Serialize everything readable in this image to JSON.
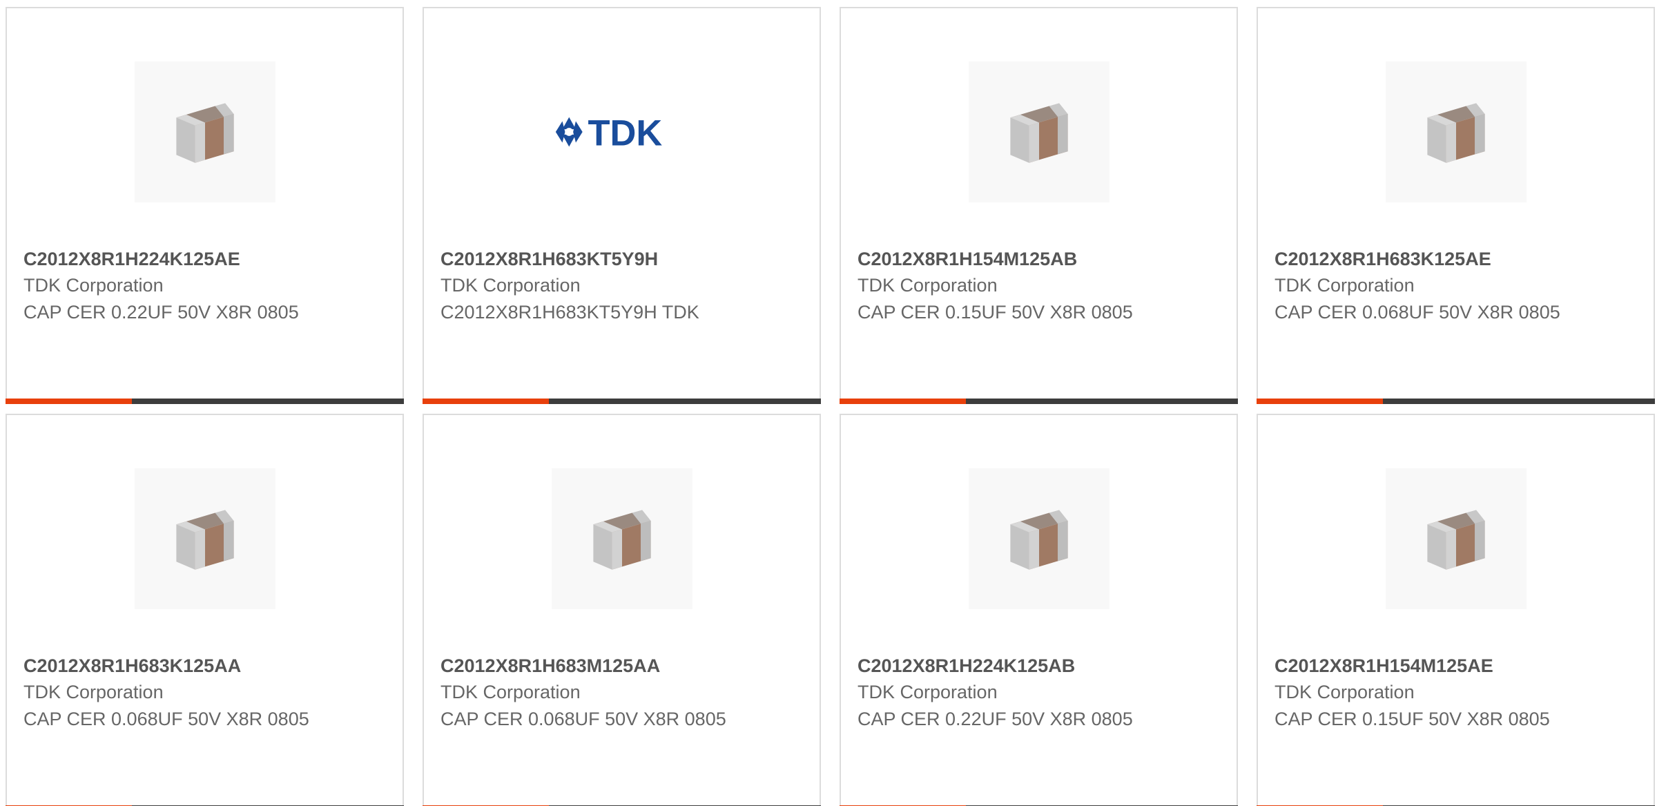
{
  "colors": {
    "accent_bar": "#e8400c",
    "dark_bar": "#3d3d3d",
    "card_border": "#dcdcdc",
    "part_number_text": "#555555",
    "body_text": "#666666",
    "tdk_logo_blue": "#1a4d9c"
  },
  "products": [
    {
      "part_number": "C2012X8R1H224K125AE",
      "manufacturer": "TDK Corporation",
      "description": "CAP CER 0.22UF 50V X8R 0805",
      "image": "capacitor-chip-icon"
    },
    {
      "part_number": "C2012X8R1H683KT5Y9H",
      "manufacturer": "TDK Corporation",
      "description": "C2012X8R1H683KT5Y9H TDK",
      "image": "tdk-logo",
      "logo_text": "TDK"
    },
    {
      "part_number": "C2012X8R1H154M125AB",
      "manufacturer": "TDK Corporation",
      "description": "CAP CER 0.15UF 50V X8R 0805",
      "image": "capacitor-chip-icon"
    },
    {
      "part_number": "C2012X8R1H683K125AE",
      "manufacturer": "TDK Corporation",
      "description": "CAP CER 0.068UF 50V X8R 0805",
      "image": "capacitor-chip-icon"
    },
    {
      "part_number": "C2012X8R1H683K125AA",
      "manufacturer": "TDK Corporation",
      "description": "CAP CER 0.068UF 50V X8R 0805",
      "image": "capacitor-chip-icon"
    },
    {
      "part_number": "C2012X8R1H683M125AA",
      "manufacturer": "TDK Corporation",
      "description": "CAP CER 0.068UF 50V X8R 0805",
      "image": "capacitor-chip-icon"
    },
    {
      "part_number": "C2012X8R1H224K125AB",
      "manufacturer": "TDK Corporation",
      "description": "CAP CER 0.22UF 50V X8R 0805",
      "image": "capacitor-chip-icon"
    },
    {
      "part_number": "C2012X8R1H154M125AE",
      "manufacturer": "TDK Corporation",
      "description": "CAP CER 0.15UF 50V X8R 0805",
      "image": "capacitor-chip-icon"
    }
  ]
}
